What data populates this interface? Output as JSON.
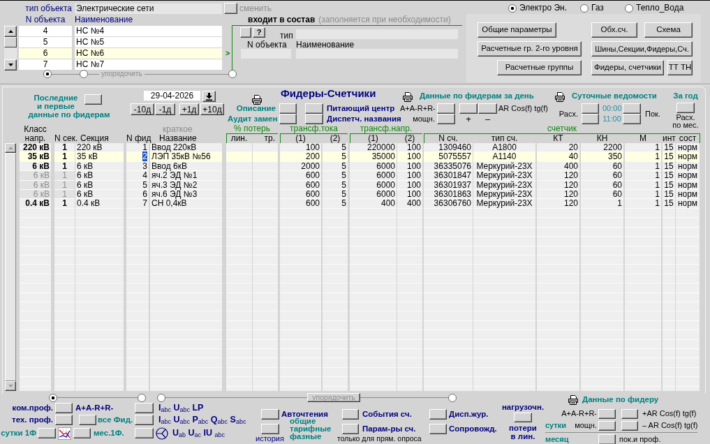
{
  "object_type": {
    "label": "тип объекта",
    "value": "Электрические сети",
    "change": {
      "label": "сменить",
      "disabled": true
    }
  },
  "energy_types": [
    {
      "label": "Электро Эн.",
      "selected": true
    },
    {
      "label": "Газ",
      "selected": false
    },
    {
      "label": "Тепло_Вода",
      "selected": false
    }
  ],
  "objects": {
    "columns": [
      "N объекта",
      "Наименование"
    ],
    "rows": [
      {
        "number": "4",
        "name": "НС №4",
        "selected": false
      },
      {
        "number": "5",
        "name": "НС №5",
        "selected": false
      },
      {
        "number": "6",
        "name": "НС №6",
        "selected": true
      },
      {
        "number": "7",
        "name": "НС №7",
        "selected": false
      }
    ],
    "marker": ">",
    "sort": {
      "label": "упорядочить",
      "disabled": true
    },
    "sort_options": [
      {
        "selected": true
      },
      {
        "selected": false
      },
      {
        "selected": false
      }
    ]
  },
  "parent": {
    "title": "входит в состав",
    "hint": "(заполняется при необходимости)",
    "help_button": "?",
    "type_label": "тип",
    "columns": [
      "N объекта",
      "Наименование"
    ]
  },
  "nav_buttons": [
    {
      "left": "Общие параметры",
      "right": [
        "Обх.сч.",
        "Схема"
      ]
    },
    {
      "left": "Расчетные гр. 2-го уровня",
      "right": [
        "Шины,Секции,Фидеры,Сч."
      ]
    },
    {
      "left": "Расчетные группы",
      "right": [
        "Фидеры, счетчики",
        "ТТ ТН"
      ]
    }
  ],
  "feeders": {
    "last_first_lines": [
      "Последние",
      "и первые",
      "данные по фидерам"
    ],
    "date": "29-04-2026",
    "date_shifts": [
      "-10д",
      "-1д",
      "+1д",
      "+10д"
    ],
    "title": "Фидеры-Счетчики",
    "info": {
      "left": [
        "Описание",
        "Аудит замен"
      ],
      "right": [
        "Питающий центр",
        "Диспетч. названия"
      ]
    },
    "day_data": {
      "title": "Данные по фидерам за день",
      "energy_label": "A+A-R+R-",
      "power_label": "мощн.",
      "ar_label": "AR Cos(f) tg(f)",
      "plus": "+",
      "minus": "–"
    },
    "daily_reports": {
      "title": "Суточные ведомости",
      "consumption_label": "Расх.",
      "times": [
        "00:00",
        "11:00"
      ],
      "readings_label": "Пок."
    },
    "year": {
      "title": "За год",
      "note_lines": [
        "Расх.",
        "по мес."
      ]
    },
    "table": {
      "header": [
        {
          "kind": "column",
          "label": "Класс напр."
        },
        {
          "kind": "column",
          "label": "N сек."
        },
        {
          "kind": "column",
          "label": "Секция"
        },
        {
          "kind": "column",
          "label": "N фид"
        },
        {
          "kind": "column",
          "label": "Название",
          "note": "краткое"
        },
        {
          "kind": "group",
          "label": "% потерь",
          "columns": [
            "лин.",
            "тр."
          ]
        },
        {
          "kind": "group",
          "label": "трансф.тока",
          "columns": [
            "(1)",
            "(2)"
          ]
        },
        {
          "kind": "group",
          "label": "трансф.напр.",
          "columns": [
            "(1)",
            "(2)"
          ]
        },
        {
          "kind": "group",
          "label": "счетчик",
          "columns": [
            "N сч.",
            "тип сч.",
            "КТ",
            "КН",
            "М",
            "инт",
            "сост"
          ]
        }
      ],
      "rows": [
        {
          "voltage_class": "220 кВ",
          "section_no": "1",
          "section": "220 кВ",
          "feeder_no": "1",
          "name": "Ввод 220кВ",
          "ct_primary": "100",
          "ct_secondary": "5",
          "vt_primary": "220000",
          "vt_secondary": "100",
          "meter_no": "1309460",
          "meter_type": "A1800",
          "kt": "20",
          "kn": "2200",
          "m": "1",
          "interval": "15",
          "state": "норм",
          "selected": false,
          "greyed": false,
          "feeder_no_highlighted": false
        },
        {
          "voltage_class": "35 кВ",
          "section_no": "1",
          "section": "35 кВ",
          "feeder_no": "2",
          "name": "ЛЭП 35кВ №56",
          "ct_primary": "200",
          "ct_secondary": "5",
          "vt_primary": "35000",
          "vt_secondary": "100",
          "meter_no": "5075557",
          "meter_type": "A1140",
          "kt": "40",
          "kn": "350",
          "m": "1",
          "interval": "15",
          "state": "норм",
          "selected": true,
          "greyed": false,
          "feeder_no_highlighted": true
        },
        {
          "voltage_class": "6 кВ",
          "section_no": "1",
          "section": "6 кВ",
          "feeder_no": "3",
          "name": "Ввод 6кВ",
          "ct_primary": "2000",
          "ct_secondary": "5",
          "vt_primary": "6000",
          "vt_secondary": "100",
          "meter_no": "36335076",
          "meter_type": "Меркурий-23Х",
          "kt": "400",
          "kn": "60",
          "m": "1",
          "interval": "15",
          "state": "норм",
          "selected": false,
          "greyed": false,
          "feeder_no_highlighted": false
        },
        {
          "voltage_class": "6 кВ",
          "section_no": "1",
          "section": "6 кВ",
          "feeder_no": "4",
          "name": "яч.2 ЭД №1",
          "ct_primary": "600",
          "ct_secondary": "5",
          "vt_primary": "6000",
          "vt_secondary": "100",
          "meter_no": "36301847",
          "meter_type": "Меркурий-23Х",
          "kt": "120",
          "kn": "60",
          "m": "1",
          "interval": "15",
          "state": "норм",
          "selected": false,
          "greyed": true,
          "feeder_no_highlighted": false
        },
        {
          "voltage_class": "6 кВ",
          "section_no": "1",
          "section": "6 кВ",
          "feeder_no": "5",
          "name": "яч.3 ЭД №2",
          "ct_primary": "600",
          "ct_secondary": "5",
          "vt_primary": "6000",
          "vt_secondary": "100",
          "meter_no": "36301937",
          "meter_type": "Меркурий-23Х",
          "kt": "120",
          "kn": "60",
          "m": "1",
          "interval": "15",
          "state": "норм",
          "selected": false,
          "greyed": true,
          "feeder_no_highlighted": false
        },
        {
          "voltage_class": "6 кВ",
          "section_no": "1",
          "section": "6 кВ",
          "feeder_no": "6",
          "name": "яч.6 ЭД №3",
          "ct_primary": "600",
          "ct_secondary": "5",
          "vt_primary": "6000",
          "vt_secondary": "100",
          "meter_no": "36301863",
          "meter_type": "Меркурий-23Х",
          "kt": "120",
          "kn": "60",
          "m": "1",
          "interval": "15",
          "state": "норм",
          "selected": false,
          "greyed": true,
          "feeder_no_highlighted": false
        },
        {
          "voltage_class": "0.4 кВ",
          "section_no": "1",
          "section": "0.4 кВ",
          "feeder_no": "7",
          "name": "СН 0,4кВ",
          "ct_primary": "600",
          "ct_secondary": "5",
          "vt_primary": "400",
          "vt_secondary": "400",
          "meter_no": "36306760",
          "meter_type": "Меркурий-23Х",
          "kt": "120",
          "kn": "1",
          "m": "1",
          "interval": "15",
          "state": "норм",
          "selected": false,
          "greyed": false,
          "feeder_no_highlighted": false
        }
      ]
    }
  },
  "bottom": {
    "sort_options": [
      {
        "selected": true
      },
      {
        "selected": false
      },
      {
        "selected": false
      },
      {
        "selected": false
      }
    ],
    "sort_button": {
      "label": "упорядочить",
      "disabled": true
    },
    "profiles": {
      "commercial": "ком.проф.",
      "technical": "тех. проф.",
      "energy": "A+A-R+R-",
      "all_feeders": "все Фид.",
      "day_1f": "сутки 1Ф",
      "month_1f": "мес.1Ф."
    },
    "phase_params": [
      "I$_{abc}$ U$_{abc}$ LP",
      "I$_{abc}$ U$_{abc}$ P$_{abc}$ Q$_{abc}$ S$_{abc}$",
      "U$_{ab}$ U$_{ac}$ IU $_{abc}$"
    ],
    "auto_reads": {
      "title": "Авточтения",
      "history": "история",
      "kinds": [
        "общие",
        "тарифные",
        "фазные"
      ]
    },
    "meter_events": {
      "events": "События сч.",
      "params": "Парам-ры сч.",
      "note": "только для прям. опроса"
    },
    "journals": [
      "Дисп.жур.",
      "Сопровожд."
    ],
    "losses": {
      "title": "нагрузочн.",
      "lines": [
        "потери",
        "в лин."
      ]
    },
    "feeder_data": {
      "title": "Данные по фидеру",
      "energy_label": "A+A-R+R-",
      "power_label": "мощн.",
      "plus_label": "+AR Cos(f) tg(f)",
      "minus_label": "– AR Cos(f) tg(f)",
      "day_label": "сутки",
      "month_label": "месяц",
      "readings_label": "пок.и проф."
    }
  }
}
